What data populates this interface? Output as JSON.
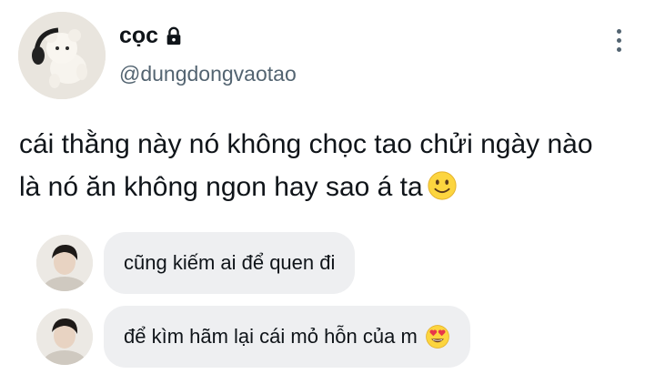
{
  "profile": {
    "display_name": "cọc",
    "handle": "@dungdongvaotao",
    "verified_icon": "lock-icon"
  },
  "tweet": {
    "line1": "cái thằng này nó không chọc tao chửi ngày nào",
    "line2": "là nó ăn không ngon hay sao á ta",
    "emoji": "slightly-smiling-face"
  },
  "replies": [
    {
      "text": "cũng kiếm ai để quen đi"
    },
    {
      "text": "để kìm hãm lại cái mỏ hỗn của m",
      "emoji": "heart-eyes-face"
    }
  ],
  "colors": {
    "text": "#0f1419",
    "secondary": "#536471",
    "bubble": "#eeeff1"
  }
}
